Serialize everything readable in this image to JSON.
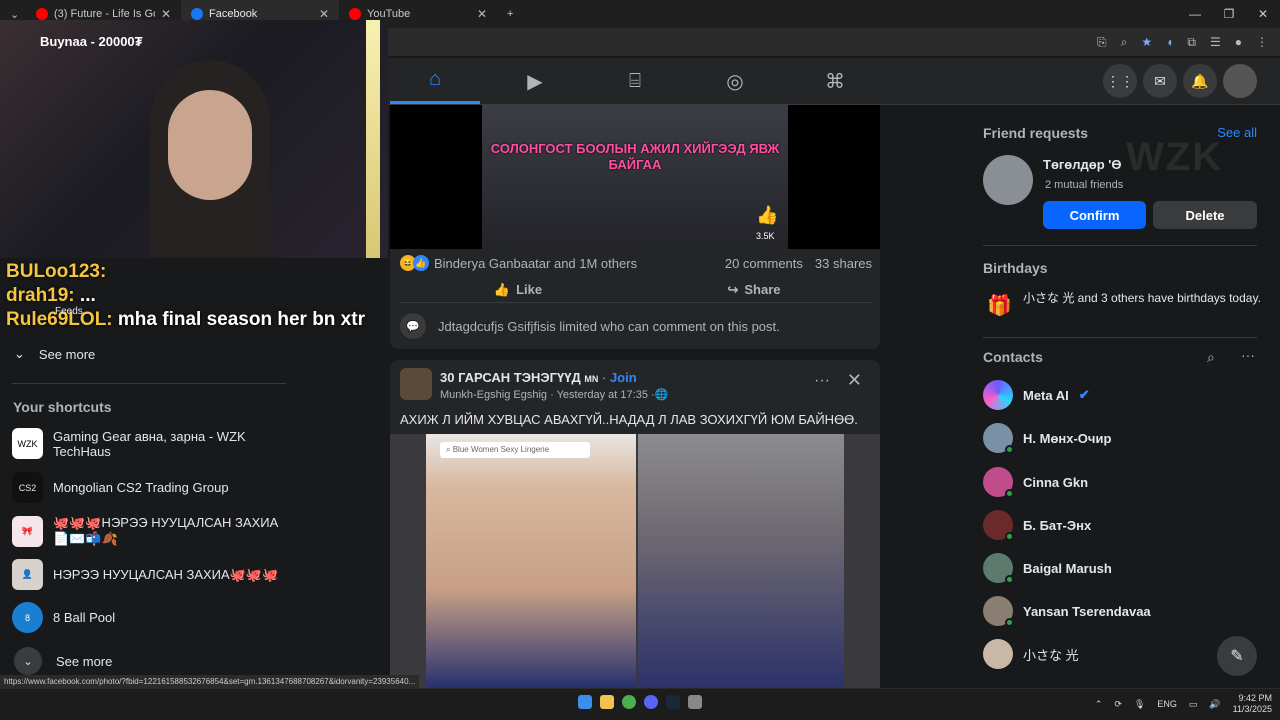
{
  "tabs": [
    {
      "title": "(3) Future - Life Is Good (Of",
      "color": "#ff0000",
      "active": false
    },
    {
      "title": "Facebook",
      "color": "#1877f2",
      "active": true
    },
    {
      "title": "YouTube",
      "color": "#ff0000",
      "active": false
    }
  ],
  "stream": {
    "subscriber_alert": "Buynaa - 20000₮",
    "chat": [
      {
        "user": "BULoo123:",
        "msg": ""
      },
      {
        "user": "drah19:",
        "msg": "..."
      },
      {
        "user": "Rule69LOL:",
        "msg": "mha final season her bn xtr"
      }
    ]
  },
  "sidebar": {
    "feeds_label": "Feeds",
    "see_more_top": "See more",
    "shortcuts_title": "Your shortcuts",
    "shortcuts": [
      {
        "label": "Gaming Gear авна, зарна - WZK TechHaus",
        "thumb": "WZK"
      },
      {
        "label": "Mongolian CS2 Trading Group",
        "thumb": "CS2"
      },
      {
        "label": "🐙🐙🐙НЭРЭЭ НУУЦАЛСАН ЗАХИА📄✉️📬🍂",
        "thumb": "🎀"
      },
      {
        "label": "НЭРЭЭ НУУЦАЛСАН ЗАХИА🐙🐙🐙",
        "thumb": "👤"
      },
      {
        "label": "8 Ball Pool",
        "thumb": "8"
      }
    ],
    "see_more_bottom": "See more"
  },
  "post1": {
    "video_caption": "СОЛОНГОСТ БООЛЫН АЖИЛ ХИЙГЭЭД ЯВЖ БАЙГАА",
    "video_likes": "3.5K",
    "reactions_text": "Binderya Ganbaatar and 1M others",
    "comments": "20 comments",
    "shares": "33 shares",
    "like_label": "Like",
    "share_label": "Share",
    "limit_notice": "Jdtagdcufjs Gsifjfisis limited who can comment on this post."
  },
  "post2": {
    "group_name": "30 ГАРСАН ТЭНЭГҮҮД",
    "group_suffix": "MN",
    "join_label": "Join",
    "author": "Munkh-Egshig Egshig",
    "time": "Yesterday at 17:35",
    "text": "АХИЖ Л ИЙМ ХУВЦАС АВАХГҮЙ..НАДАД Л ЛАВ ЗОХИХГҮЙ ЮМ БАЙНӨӨ.",
    "image_search": "Blue Women Sexy Lingerie"
  },
  "rail": {
    "friend_requests_title": "Friend requests",
    "see_all": "See all",
    "request_name": "Төгөлдөр 'Ө",
    "mutual": "2 mutual friends",
    "confirm": "Confirm",
    "delete": "Delete",
    "birthdays_title": "Birthdays",
    "birthday_text": "小さな 光 and 3 others have birthdays today.",
    "contacts_title": "Contacts",
    "contacts": [
      {
        "name": "Meta AI",
        "color": "#6a5cff",
        "online": false
      },
      {
        "name": "Н. Мөнх-Очир",
        "color": "#7a8fa8",
        "online": true
      },
      {
        "name": "Cinna Gkn",
        "color": "#c04c8c",
        "online": true
      },
      {
        "name": "Б. Бат-Энх",
        "color": "#6b2a2a",
        "online": true
      },
      {
        "name": "Baigal Marush",
        "color": "#5d7a6e",
        "online": true
      },
      {
        "name": "Yansan Tserendavaa",
        "color": "#8a7d72",
        "online": true
      },
      {
        "name": "小さな 光",
        "color": "#c9b8a6",
        "online": false
      }
    ],
    "watermark": "WZK"
  },
  "status_url": "https://www.facebook.com/photo/?fbid=122161588532676854&set=gm.1361347688708267&idorvanity=23935640...",
  "taskbar": {
    "lang": "ENG",
    "time": "9:42 PM",
    "date": "11/3/2025"
  },
  "colors": {
    "accent": "#2d88ff",
    "confirm": "#0866ff"
  }
}
